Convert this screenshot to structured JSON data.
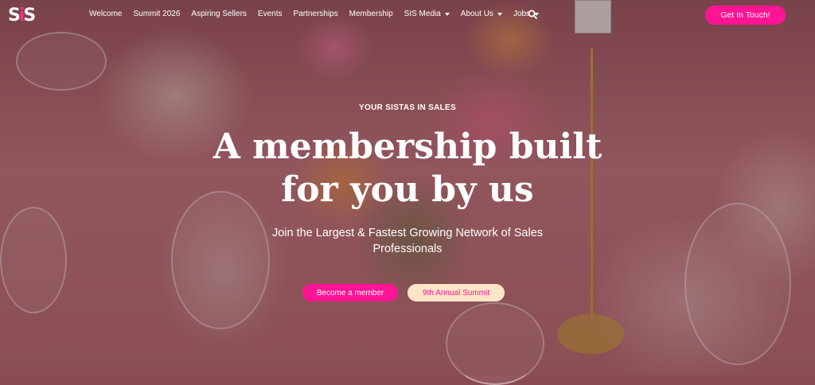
{
  "logo": {
    "left": "S",
    "mid": "i",
    "right": "S"
  },
  "nav": {
    "items": [
      {
        "label": "Welcome",
        "dropdown": false
      },
      {
        "label": "Summit 2026",
        "dropdown": false
      },
      {
        "label": "Aspiring Sellers",
        "dropdown": false
      },
      {
        "label": "Events",
        "dropdown": false
      },
      {
        "label": "Partnerships",
        "dropdown": false
      },
      {
        "label": "Membership",
        "dropdown": false
      },
      {
        "label": "SIS Media",
        "dropdown": true
      },
      {
        "label": "About Us",
        "dropdown": true
      },
      {
        "label": "Jobs",
        "dropdown": true
      }
    ],
    "search_icon": "search-icon",
    "cta_label": "Get In Touch!"
  },
  "hero": {
    "eyebrow": "YOUR SISTAS IN SALES",
    "headline_line1": "A membership built",
    "headline_line2": "for you by us",
    "subline_line1": "Join the Largest & Fastest Growing Network of Sales",
    "subline_line2": "Professionals",
    "primary_button": "Become a member",
    "secondary_button": "9th Annual Summit"
  },
  "colors": {
    "accent": "#ff1493",
    "secondary_button_bg": "#ffe5c8",
    "text": "#ffffff"
  }
}
